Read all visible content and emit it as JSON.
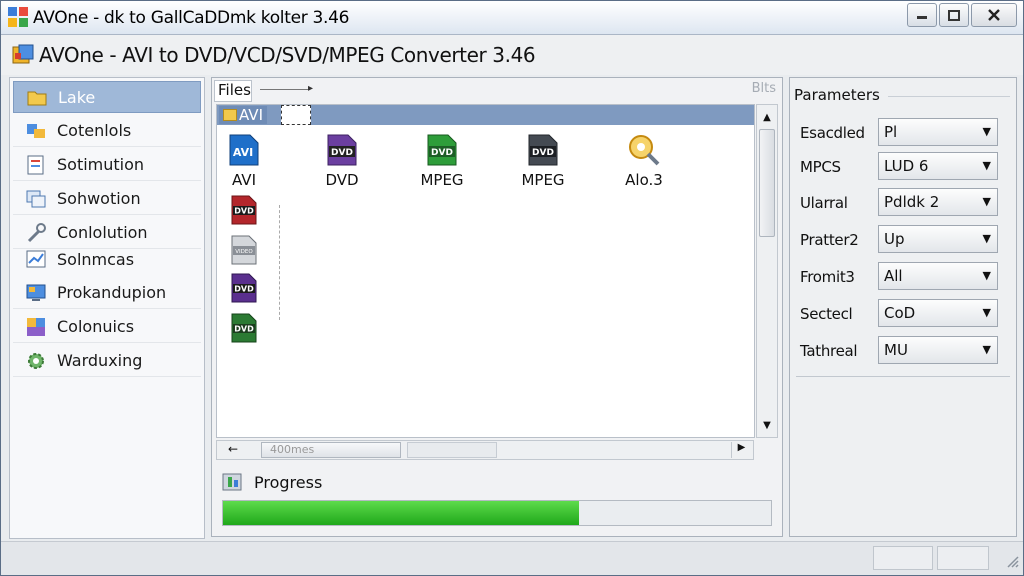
{
  "window": {
    "title": "AVOne - dk to GallCaDDmk kolter 3.46",
    "header_title": "AVOne - AVI to DVD/VCD/SVD/MPEG Converter 3.46"
  },
  "sidebar": {
    "items": [
      {
        "label": "Lake",
        "icon": "folder-icon",
        "active": true
      },
      {
        "label": "Cotenlols",
        "icon": "controls-icon"
      },
      {
        "label": "Sotimution",
        "icon": "document-icon"
      },
      {
        "label": "Sohwotion",
        "icon": "windows-icon"
      },
      {
        "label": "Conlolution",
        "icon": "wrench-icon"
      },
      {
        "label": "Solnmcas",
        "icon": "chart-icon"
      },
      {
        "label": "Prokandupion",
        "icon": "monitor-icon"
      },
      {
        "label": "Colonuics",
        "icon": "palette-icon"
      },
      {
        "label": "Warduxing",
        "icon": "gear-icon"
      }
    ]
  },
  "files": {
    "tab_label": "Files",
    "corner_label": "Blts",
    "selected_folder": "AVI",
    "grid": [
      {
        "label": "AVI",
        "icon": "avi-file-icon",
        "badge": "AVI",
        "color": "#1f6fc9"
      },
      {
        "label": "DVD",
        "icon": "dvd-file-icon",
        "badge": "DVD",
        "color": "#6b3fa0"
      },
      {
        "label": "MPEG",
        "icon": "mpeg-file-icon",
        "badge": "DVD",
        "color": "#2e9d3a"
      },
      {
        "label": "MPEG",
        "icon": "mpeg-file-icon-2",
        "badge": "DVD",
        "color": "#444a52"
      },
      {
        "label": "Alo.3",
        "icon": "search-disc-icon",
        "badge": "",
        "color": "#e0a21a"
      }
    ],
    "column_icons": [
      {
        "icon": "dvd-red-icon",
        "badge": "DVD",
        "color": "#b3262b"
      },
      {
        "icon": "video-gray-icon",
        "badge": "VIDEO",
        "color": "#8a8f96"
      },
      {
        "icon": "dvd-purple-icon",
        "badge": "DVD",
        "color": "#5a2f8e"
      },
      {
        "icon": "dvd-green-icon",
        "badge": "DVD",
        "color": "#2b7a33"
      }
    ],
    "hscroll_text": "400mes"
  },
  "progress": {
    "label": "Progress",
    "fraction": 0.65
  },
  "parameters": {
    "title": "Parameters",
    "rows": [
      {
        "label": "Esacdled",
        "value": "Pl"
      },
      {
        "label": "MPCS",
        "value": "LUD 6"
      },
      {
        "label": "Ularral",
        "value": "Pdldk 2"
      },
      {
        "label": "Pratter2",
        "value": "Up"
      },
      {
        "label": "Fromit3",
        "value": "All"
      },
      {
        "label": "Sectecl",
        "value": "CoD"
      },
      {
        "label": "Tathreal",
        "value": "MU"
      }
    ]
  },
  "colors": {
    "accent": "#9fb8d8",
    "selection": "#7f9ac0",
    "progress_green": "#2cb526"
  }
}
